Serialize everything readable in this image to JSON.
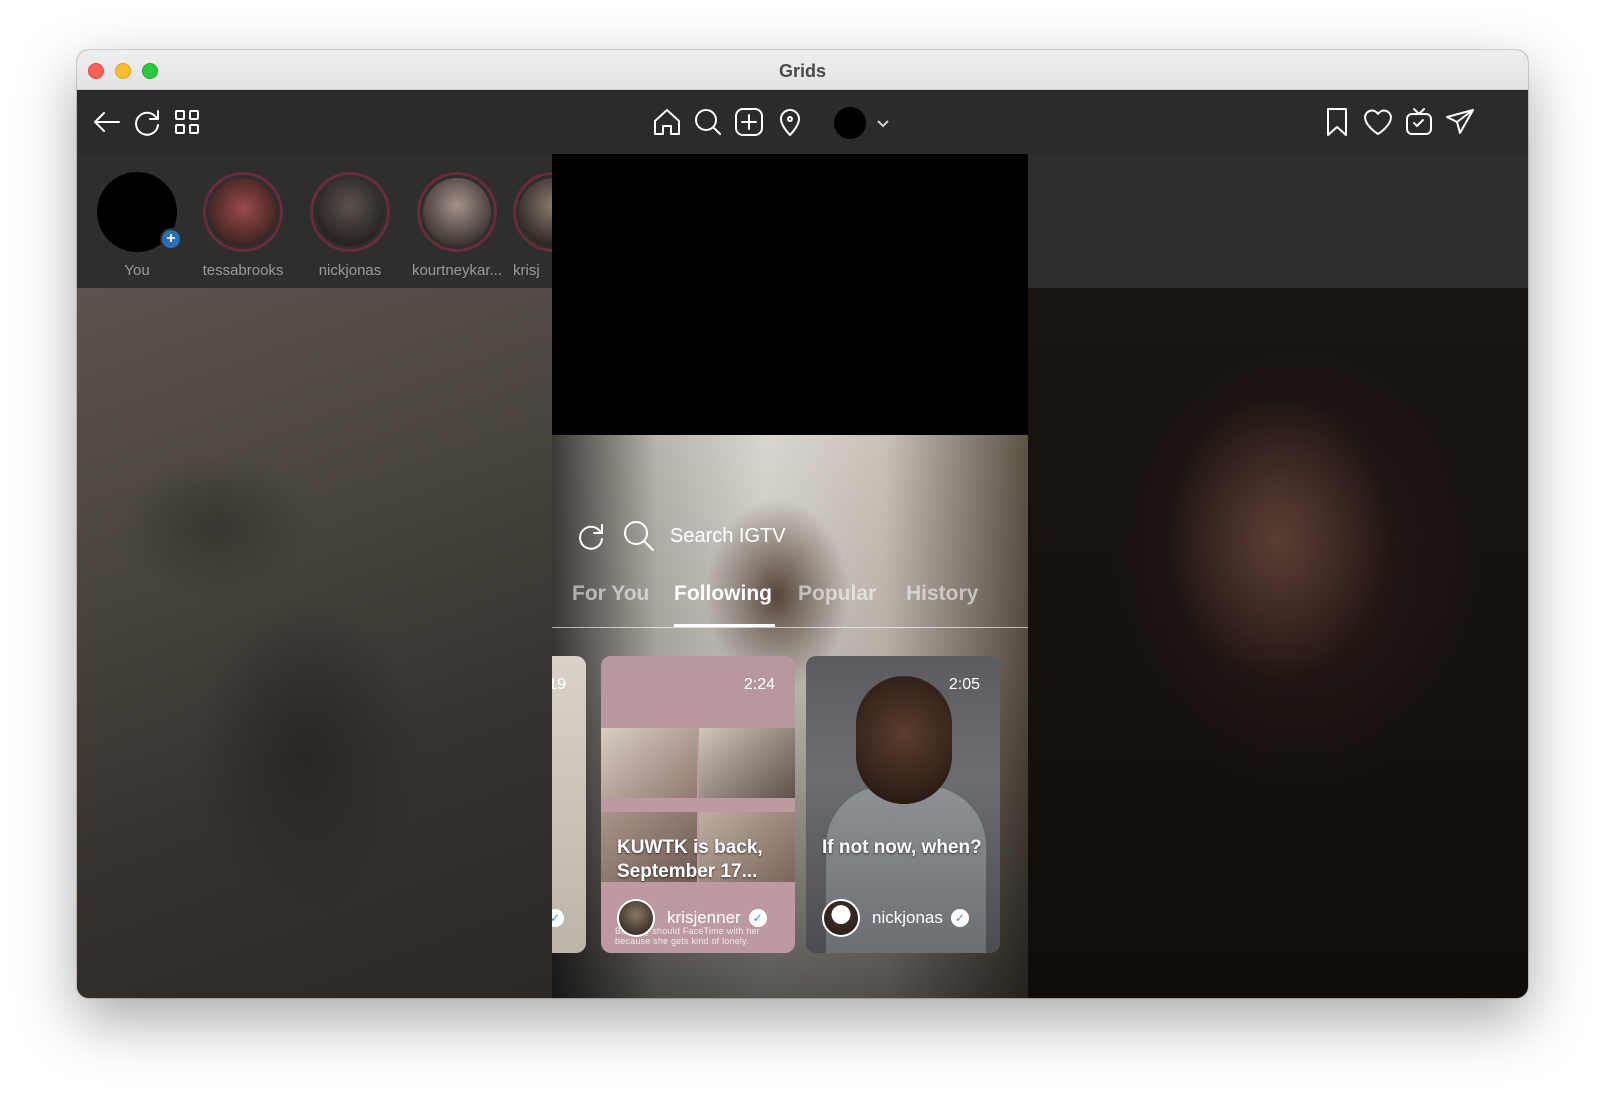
{
  "window": {
    "title": "Grids"
  },
  "toolbar": {
    "left_icons": [
      "back-arrow-icon",
      "refresh-icon",
      "grid-icon"
    ],
    "center_icons": [
      "home-icon",
      "search-icon",
      "add-post-icon",
      "location-pin-icon"
    ],
    "right_icons": [
      "bookmark-icon",
      "heart-icon",
      "igtv-icon",
      "direct-message-icon"
    ]
  },
  "stories": [
    {
      "label": "You",
      "is_self": true
    },
    {
      "label": "tessabrooks"
    },
    {
      "label": "nickjonas"
    },
    {
      "label": "kourtneykar..."
    },
    {
      "label": "krisj"
    }
  ],
  "igtv": {
    "search_placeholder": "Search IGTV",
    "tabs": [
      {
        "label": "For You",
        "active": false
      },
      {
        "label": "Following",
        "active": true
      },
      {
        "label": "Popular",
        "active": false
      },
      {
        "label": "History",
        "active": false
      }
    ],
    "cards": [
      {
        "duration": "19",
        "title": "",
        "username": "",
        "verified": true
      },
      {
        "duration": "2:24",
        "title": "KUWTK is back, September 17...",
        "username": "krisjenner",
        "verified": true,
        "caption": "But they should FaceTime with her because she gets kind of lonely."
      },
      {
        "duration": "2:05",
        "title": "If not now, when?",
        "username": "nickjonas",
        "verified": true
      }
    ]
  },
  "colors": {
    "titlebar": "#e6e6e6",
    "toolbar": "#2b2b2b",
    "stories_bar": "#2e2e2e",
    "story_ring": "#6b2a3a",
    "add_badge": "#2a6fb5",
    "active_tab": "#ffffff",
    "inactive_tab": "#a9a9a9"
  }
}
